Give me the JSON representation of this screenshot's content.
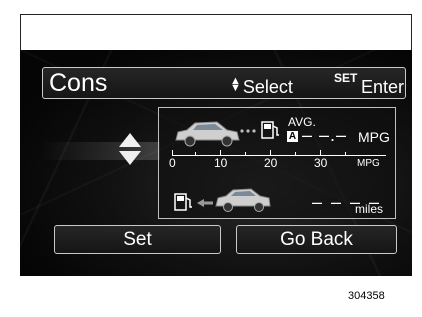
{
  "header": {
    "title": "Cons",
    "select_label": "Select",
    "set_label": "SET",
    "enter_label": "Enter"
  },
  "fuel_panel": {
    "avg_label": "AVG.",
    "avg_badge": "A",
    "avg_value": "– –.–",
    "avg_unit": "MPG",
    "scale_ticks": [
      "0",
      "10",
      "20",
      "30"
    ],
    "scale_unit": "MPG",
    "range_value": "– – – –",
    "range_unit": "miles"
  },
  "buttons": {
    "set_label": "Set",
    "back_label": "Go Back"
  },
  "figure_id": "304358",
  "colors": {
    "screen_background": "#0b0b0b",
    "text": "#ffffff",
    "border": "#c9c9c9"
  }
}
